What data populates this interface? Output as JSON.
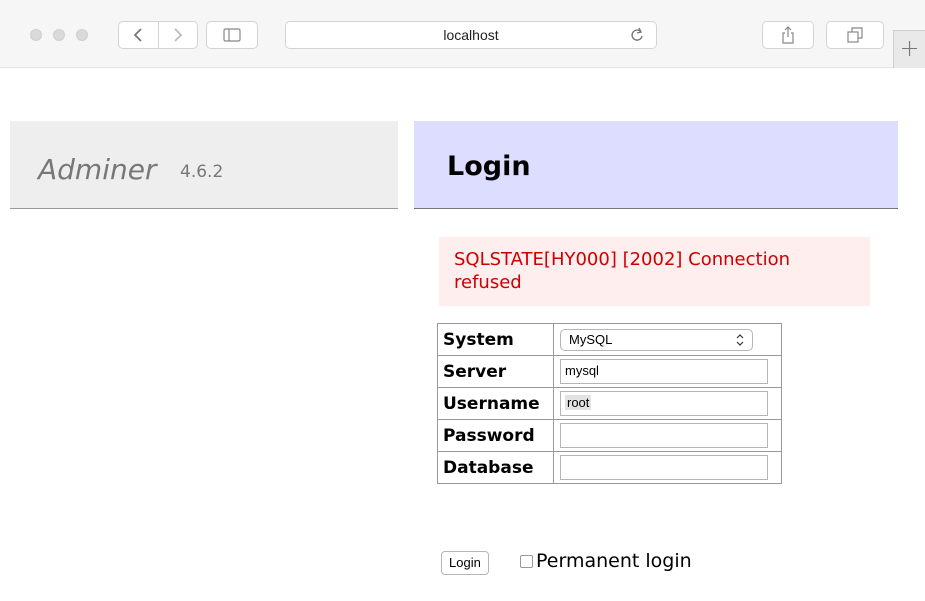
{
  "browser": {
    "url": "localhost",
    "icons": [
      "back-icon",
      "forward-icon",
      "sidebar-icon",
      "reload-icon",
      "share-icon",
      "tabs-icon",
      "new-tab-icon"
    ],
    "new_tab_glyph": "+"
  },
  "header": {
    "app_name": "Adminer",
    "version": "4.6.2",
    "page_title": "Login"
  },
  "error": {
    "message": "SQLSTATE[HY000] [2002] Connection refused"
  },
  "form": {
    "fields": [
      {
        "label": "System",
        "type": "select",
        "value": "MySQL"
      },
      {
        "label": "Server",
        "type": "text",
        "value": "mysql"
      },
      {
        "label": "Username",
        "type": "text",
        "value": "root"
      },
      {
        "label": "Password",
        "type": "password",
        "value": ""
      },
      {
        "label": "Database",
        "type": "text",
        "value": ""
      }
    ],
    "submit_label": "Login",
    "permanent_label": "Permanent login",
    "permanent_checked": false
  },
  "colors": {
    "login_header_bg": "#ddddff",
    "error_bg": "#ffeeee",
    "error_text": "#cc0000"
  }
}
